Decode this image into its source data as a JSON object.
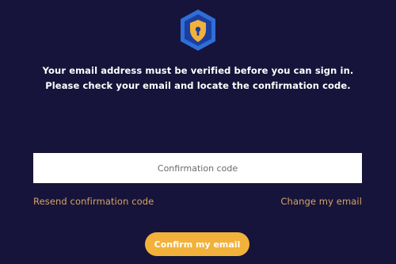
{
  "logo": {
    "icon": "shield-lock-icon",
    "colors": {
      "outer": "#2f6ed8",
      "inner": "#1c3f9e",
      "lock": "#f2b13a"
    }
  },
  "message": {
    "line1": "Your email address must be verified before you can sign in.",
    "line2": "Please check your email and locate the confirmation code."
  },
  "form": {
    "code_placeholder": "Confirmation code",
    "code_value": "",
    "resend_label": "Resend confirmation code",
    "change_email_label": "Change my email",
    "confirm_label": "Confirm my email"
  },
  "colors": {
    "background": "#16143a",
    "accent": "#f2b13a",
    "link": "#d9a366"
  }
}
